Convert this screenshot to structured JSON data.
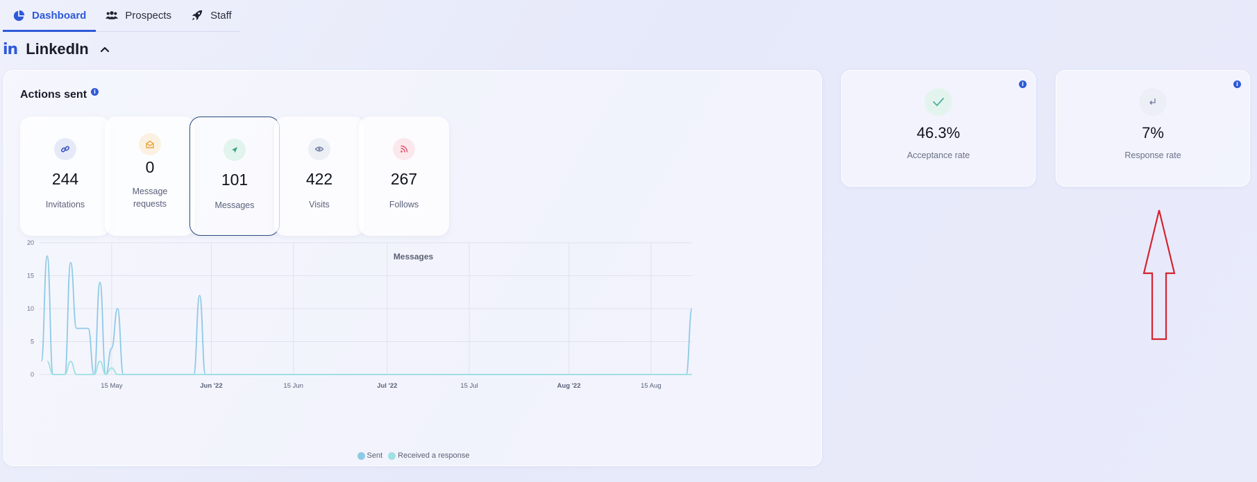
{
  "tabs": [
    {
      "label": "Dashboard",
      "icon": "pie-chart-icon",
      "active": true
    },
    {
      "label": "Prospects",
      "icon": "users-icon",
      "active": false
    },
    {
      "label": "Staff",
      "icon": "rocket-icon",
      "active": false
    }
  ],
  "section": {
    "logo": "in",
    "title": "LinkedIn"
  },
  "actions": {
    "title": "Actions sent",
    "info": "i",
    "stats": [
      {
        "value": "244",
        "label": "Invitations",
        "icon": "link-icon",
        "color": "#3a56c4",
        "bg": "#e6eaf8"
      },
      {
        "value": "0",
        "label": "Message requests",
        "icon": "mail-open-icon",
        "color": "#e9a43b",
        "bg": "#fbf1e3"
      },
      {
        "value": "101",
        "label": "Messages",
        "icon": "send-icon",
        "color": "#2f9e7c",
        "bg": "#e1f4ee"
      },
      {
        "value": "422",
        "label": "Visits",
        "icon": "eye-icon",
        "color": "#6a7a9c",
        "bg": "#eceff6"
      },
      {
        "value": "267",
        "label": "Follows",
        "icon": "rss-icon",
        "color": "#e5556e",
        "bg": "#fbe8ec"
      }
    ]
  },
  "rates": [
    {
      "value": "46.3%",
      "label": "Acceptance rate",
      "icon": "check-icon",
      "color": "#4fae9d",
      "bg": "#e3f4ef",
      "info": "i"
    },
    {
      "value": "7%",
      "label": "Response rate",
      "icon": "reply-icon",
      "color": "#6a7a9c",
      "bg": "#eceff6",
      "info": "i"
    }
  ],
  "chart_data": {
    "type": "line",
    "title": "Messages",
    "ylim": [
      0,
      20
    ],
    "yticks": [
      "0",
      "5",
      "10",
      "15",
      "20"
    ],
    "xticks": [
      {
        "label": "15 May",
        "bold": false
      },
      {
        "label": "Jun '22",
        "bold": true
      },
      {
        "label": "15 Jun",
        "bold": false
      },
      {
        "label": "Jul '22",
        "bold": true
      },
      {
        "label": "15 Jul",
        "bold": false
      },
      {
        "label": "Aug '22",
        "bold": true
      },
      {
        "label": "15 Aug",
        "bold": false
      }
    ],
    "grid": true,
    "legend_placement": "bottom",
    "series": [
      {
        "name": "Sent",
        "color": "#8ec9e6",
        "points": [
          [
            -12,
            2
          ],
          [
            -11,
            18
          ],
          [
            -10,
            0
          ],
          [
            -8,
            0
          ],
          [
            -7,
            17
          ],
          [
            -6,
            7
          ],
          [
            -4,
            7
          ],
          [
            -3,
            0
          ],
          [
            -2,
            14
          ],
          [
            -1,
            0
          ],
          [
            0,
            4
          ],
          [
            1,
            10
          ],
          [
            2,
            0
          ],
          [
            14,
            0
          ],
          [
            15,
            12
          ],
          [
            16,
            0
          ],
          [
            98,
            0
          ],
          [
            99,
            10
          ]
        ]
      },
      {
        "name": "Received a response",
        "color": "#9fe0e3",
        "points": [
          [
            -11,
            2
          ],
          [
            -10,
            0
          ],
          [
            -8,
            0
          ],
          [
            -7,
            2
          ],
          [
            -6,
            0
          ],
          [
            -3,
            0
          ],
          [
            -2,
            2
          ],
          [
            -1,
            0
          ],
          [
            0,
            1
          ],
          [
            1,
            0
          ],
          [
            99,
            0
          ]
        ]
      }
    ]
  },
  "annotation": {
    "color": "#d42430"
  }
}
